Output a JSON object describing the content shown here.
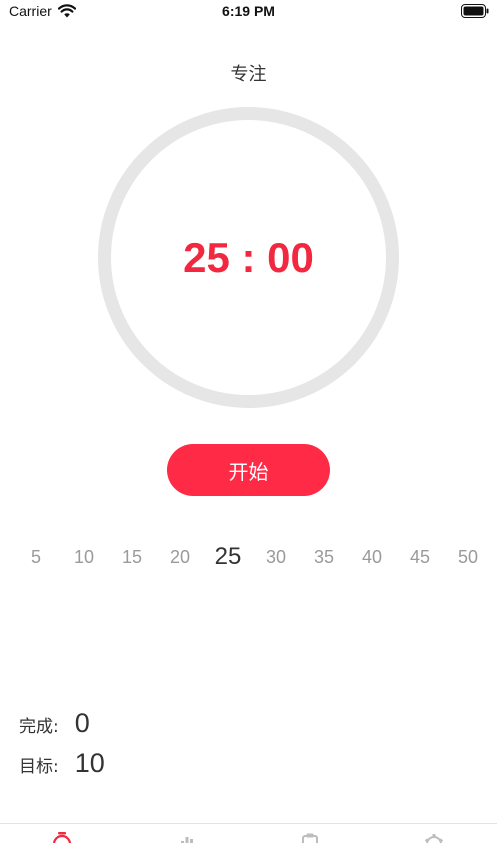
{
  "status_bar": {
    "carrier": "Carrier",
    "time": "6:19 PM"
  },
  "title": "专注",
  "timer": {
    "display": "25 : 00",
    "ring_color": "#e6e6e6",
    "accent_color": "#f1283f"
  },
  "start_button": {
    "label": "开始",
    "color": "#ff2a45"
  },
  "durations": {
    "options": [
      "5",
      "10",
      "15",
      "20",
      "25",
      "30",
      "35",
      "40",
      "45",
      "50"
    ],
    "selected": "25"
  },
  "stats": {
    "completed_label": "完成:",
    "completed_value": "0",
    "target_label": "目标:",
    "target_value": "10"
  },
  "tab_bar": {
    "tabs": [
      {
        "icon": "timer-icon",
        "active": true
      },
      {
        "icon": "bar-chart-icon",
        "active": false
      },
      {
        "icon": "clipboard-icon",
        "active": false
      },
      {
        "icon": "gear-icon",
        "active": false
      }
    ]
  }
}
